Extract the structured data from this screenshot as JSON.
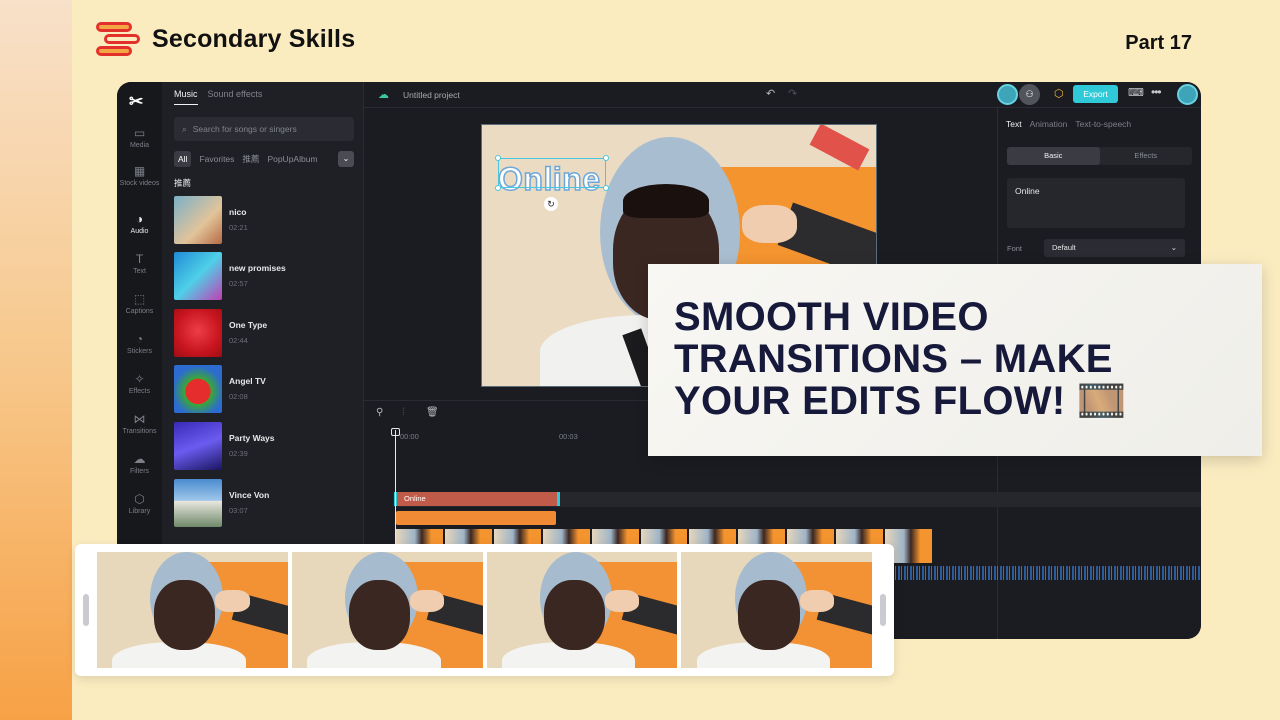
{
  "brand": {
    "name": "Secondary Skills",
    "part": "Part 17"
  },
  "editor": {
    "app_logo": "✂",
    "nav": [
      {
        "label": "Media",
        "icon": "media-icon",
        "glyph": "▭"
      },
      {
        "label": "Stock videos",
        "icon": "stock-videos-icon",
        "glyph": "▦"
      },
      {
        "label": "Audio",
        "icon": "audio-icon",
        "glyph": "◑"
      },
      {
        "label": "Text",
        "icon": "text-icon",
        "glyph": "T"
      },
      {
        "label": "Captions",
        "icon": "captions-icon",
        "glyph": "⬚"
      },
      {
        "label": "Stickers",
        "icon": "stickers-icon",
        "glyph": "◔"
      },
      {
        "label": "Effects",
        "icon": "effects-icon",
        "glyph": "✧"
      },
      {
        "label": "Transitions",
        "icon": "transitions-icon",
        "glyph": "⋈"
      },
      {
        "label": "Filters",
        "icon": "filters-icon",
        "glyph": "☁"
      },
      {
        "label": "Library",
        "icon": "library-icon",
        "glyph": "⬡"
      }
    ],
    "music_panel": {
      "tabs": [
        "Music",
        "Sound effects"
      ],
      "search_placeholder": "Search for songs or singers",
      "filters": [
        "All",
        "Favorites",
        "推薦",
        "PopUpAlbum"
      ],
      "section": "推薦",
      "tracks": [
        {
          "name": "nico",
          "duration": "02:21"
        },
        {
          "name": "new promises",
          "duration": "02:57"
        },
        {
          "name": "One Type",
          "duration": "02:44"
        },
        {
          "name": "Angel TV",
          "duration": "02:08"
        },
        {
          "name": "Party Ways",
          "duration": "02:39"
        },
        {
          "name": "Vince Von",
          "duration": "03:07"
        }
      ]
    },
    "topbar": {
      "project_title": "Untitled project",
      "export_label": "Export"
    },
    "canvas": {
      "overlay_text": "Online"
    },
    "props": {
      "tabs": [
        "Text",
        "Animation",
        "Text-to-speech"
      ],
      "segments": [
        "Basic",
        "Effects"
      ],
      "text_value": "Online",
      "font_label": "Font",
      "font_value": "Default"
    },
    "timeline": {
      "ticks": [
        "00:00",
        "00:03"
      ],
      "text_clip": "Online"
    }
  },
  "headline": "SMOOTH VIDEO TRANSITIONS – MAKE YOUR EDITS FLOW! 🎞️",
  "colors": {
    "accent": "#2fc9d8",
    "brand_red": "#e2312b",
    "headline": "#16193a",
    "background": "#fbecc0"
  }
}
